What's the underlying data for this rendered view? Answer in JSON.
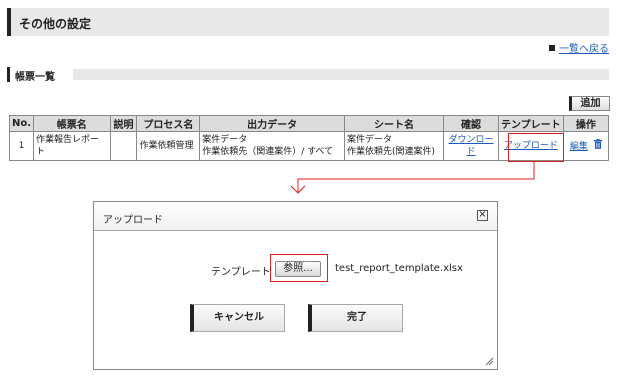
{
  "page": {
    "title": "その他の設定"
  },
  "back_link": {
    "label": "一覧へ戻る"
  },
  "section": {
    "title": "帳票一覧"
  },
  "add_button": {
    "label": "追加"
  },
  "table": {
    "headers": [
      "No.",
      "帳票名",
      "説明",
      "プロセス名",
      "出力データ",
      "シート名",
      "確認",
      "テンプレート",
      "操作"
    ],
    "rows": [
      {
        "no": "1",
        "report_name": "作業報告レポート",
        "description": "",
        "process_name": "作業依頼管理",
        "output_data_line1": "案件データ",
        "output_data_line2": "作業依頼先（関連案件）/ すべて",
        "sheet_line1": "案件データ",
        "sheet_line2": "作業依頼先(関連案件)",
        "confirm_link": "ダウンロード",
        "template_link": "アップロード",
        "edit_link": "編集",
        "delete_icon": "trash-icon"
      }
    ]
  },
  "dialog": {
    "title": "アップロード",
    "template_label": "テンプレート",
    "browse_button": "参照...",
    "filename": "test_report_template.xlsx",
    "cancel_button": "キャンセル",
    "done_button": "完了"
  },
  "colors": {
    "highlight": "#e02020",
    "link": "#1a5ab8",
    "header_bg": "#e8e8e8"
  }
}
